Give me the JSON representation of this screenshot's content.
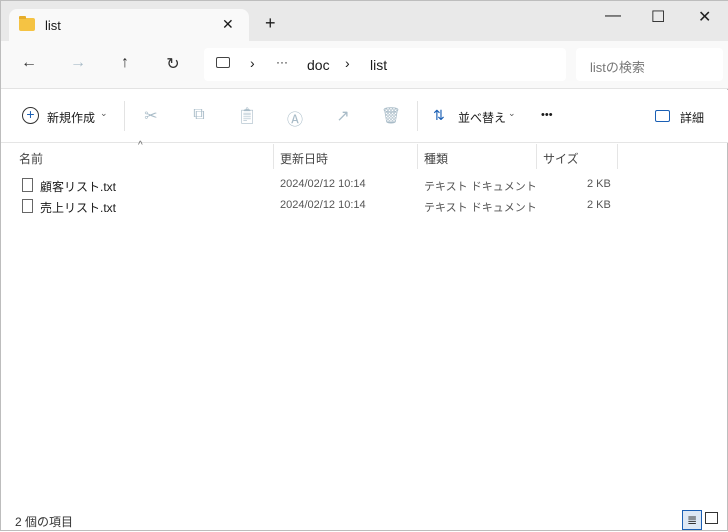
{
  "window": {
    "tab_title": "list",
    "new_tab": "+",
    "minimize": "—",
    "maximize": "☐",
    "close": "✕",
    "tab_close": "✕"
  },
  "nav": {
    "back": "←",
    "forward": "→",
    "up": "↑",
    "refresh": "↻",
    "path": [
      "doc",
      "list"
    ],
    "ellipsis": "···",
    "search_placeholder": "listの検索"
  },
  "toolbar": {
    "new_label": "新規作成",
    "sort_label": "並べ替え",
    "more": "•••",
    "details_label": "詳細"
  },
  "columns": [
    "名前",
    "更新日時",
    "種類",
    "サイズ"
  ],
  "files": [
    {
      "name": "顧客リスト.txt",
      "modified": "2024/02/12 10:14",
      "type": "テキスト ドキュメント",
      "size": "2 KB"
    },
    {
      "name": "売上リスト.txt",
      "modified": "2024/02/12 10:14",
      "type": "テキスト ドキュメント",
      "size": "2 KB"
    }
  ],
  "status": {
    "count": "2 個の項目"
  }
}
